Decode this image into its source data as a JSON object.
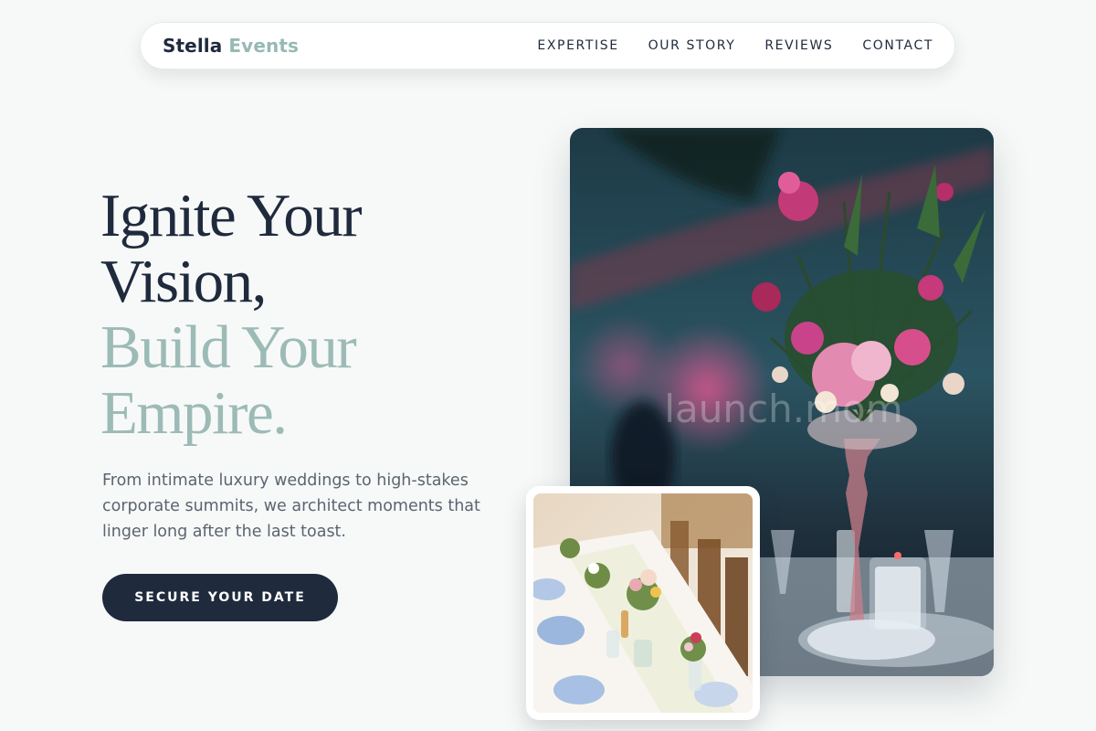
{
  "brand": {
    "name_primary": "Stella",
    "name_accent": "Events"
  },
  "nav": {
    "items": [
      "EXPERTISE",
      "OUR STORY",
      "REVIEWS",
      "CONTACT"
    ]
  },
  "hero": {
    "headline_line1": "Ignite Your",
    "headline_line2": "Vision,",
    "headline_line3": "Build Your",
    "headline_line4": "Empire.",
    "lede": "From intimate luxury weddings to high-stakes corporate summits, we architect moments that linger long after the last toast.",
    "cta_label": "SECURE YOUR DATE"
  },
  "images": {
    "main_alt": "Floral centerpiece in a silver vase at an evening reception",
    "small_alt": "Long banquet table with flower arrangements and glassware",
    "watermark": "launch.mom"
  },
  "colors": {
    "navy": "#1f2a3d",
    "sage": "#9dbbb6",
    "background": "#f7f9f8",
    "body_text": "#5b6470"
  }
}
